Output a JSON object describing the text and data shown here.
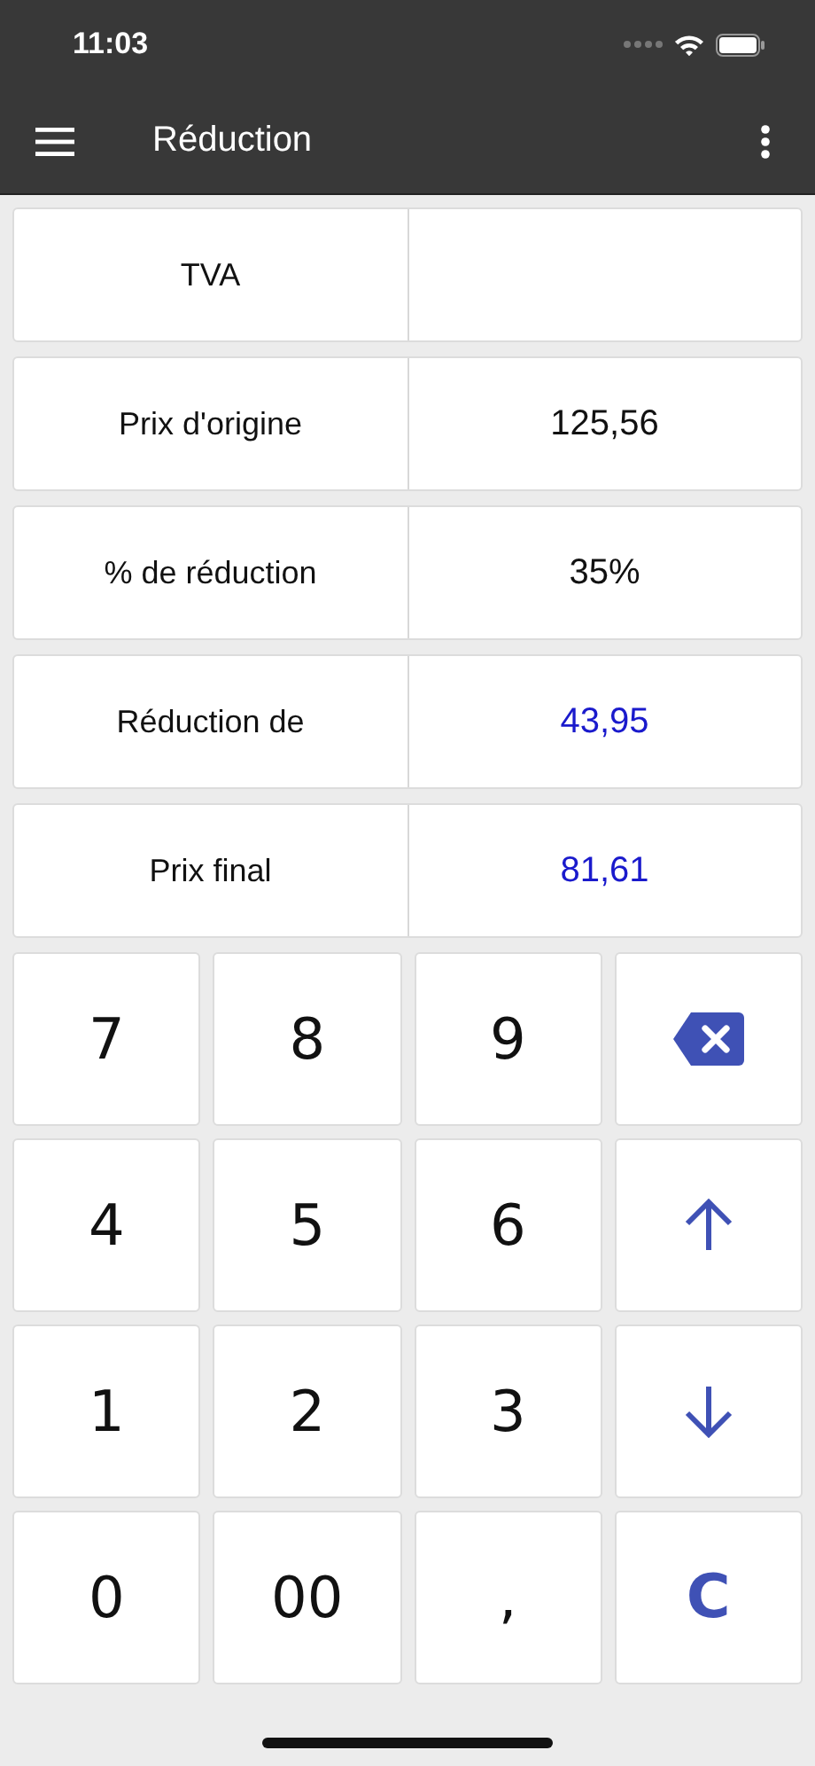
{
  "status_bar": {
    "time": "11:03"
  },
  "app_bar": {
    "title": "Réduction"
  },
  "fields": [
    {
      "label": "TVA",
      "kind": "input"
    },
    {
      "label": "Prix d'origine",
      "value": "125,56",
      "kind": "input"
    },
    {
      "label": "% de réduction",
      "value": "35%",
      "kind": "input"
    },
    {
      "label": "Réduction de",
      "value": "43,95",
      "kind": "result"
    },
    {
      "label": "Prix final",
      "value": "81,61",
      "kind": "result"
    }
  ],
  "keys": [
    {
      "kind": "digit",
      "label": "7"
    },
    {
      "kind": "digit",
      "label": "8"
    },
    {
      "kind": "digit",
      "label": "9"
    },
    {
      "kind": "backspace"
    },
    {
      "kind": "digit",
      "label": "4"
    },
    {
      "kind": "digit",
      "label": "5"
    },
    {
      "kind": "digit",
      "label": "6"
    },
    {
      "kind": "up"
    },
    {
      "kind": "digit",
      "label": "1"
    },
    {
      "kind": "digit",
      "label": "2"
    },
    {
      "kind": "digit",
      "label": "3"
    },
    {
      "kind": "down"
    },
    {
      "kind": "digit",
      "label": "0"
    },
    {
      "kind": "digit",
      "label": "00"
    },
    {
      "kind": "digit",
      "label": ","
    },
    {
      "kind": "clear",
      "label": "C"
    }
  ]
}
